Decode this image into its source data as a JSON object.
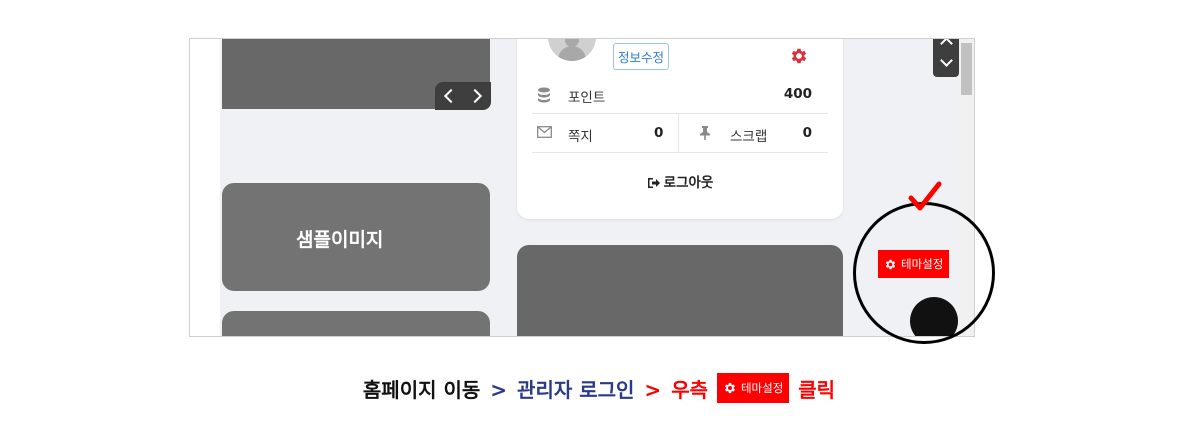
{
  "screenshot": {
    "slider_prev": "<",
    "slider_next": ">",
    "sample_image_label": "샘플이미지",
    "profile": {
      "edit_button": "정보수정",
      "points_label": "포인트",
      "points_value": "400",
      "memo_label": "쪽지",
      "memo_value": "0",
      "scrap_label": "스크랩",
      "scrap_value": "0",
      "logout_label": "로그아웃"
    },
    "theme_button": "테마설정"
  },
  "caption": {
    "step1": "홈페이지 이동",
    "sep1": ">",
    "step2": "관리자 로그인",
    "sep2": ">",
    "step3_prefix": "우측",
    "step3_button": "테마설정",
    "step3_suffix": "클릭"
  },
  "colors": {
    "accent_red": "#ff0000",
    "caption_blue": "#2a3a8a",
    "edit_blue": "#2f7bd0",
    "placeholder_gray": "#737373"
  },
  "icons": [
    "database-icon",
    "envelope-icon",
    "pin-icon",
    "logout-icon",
    "gear-icon",
    "checkmark-icon",
    "chevron-up-icon",
    "chevron-down-icon"
  ]
}
